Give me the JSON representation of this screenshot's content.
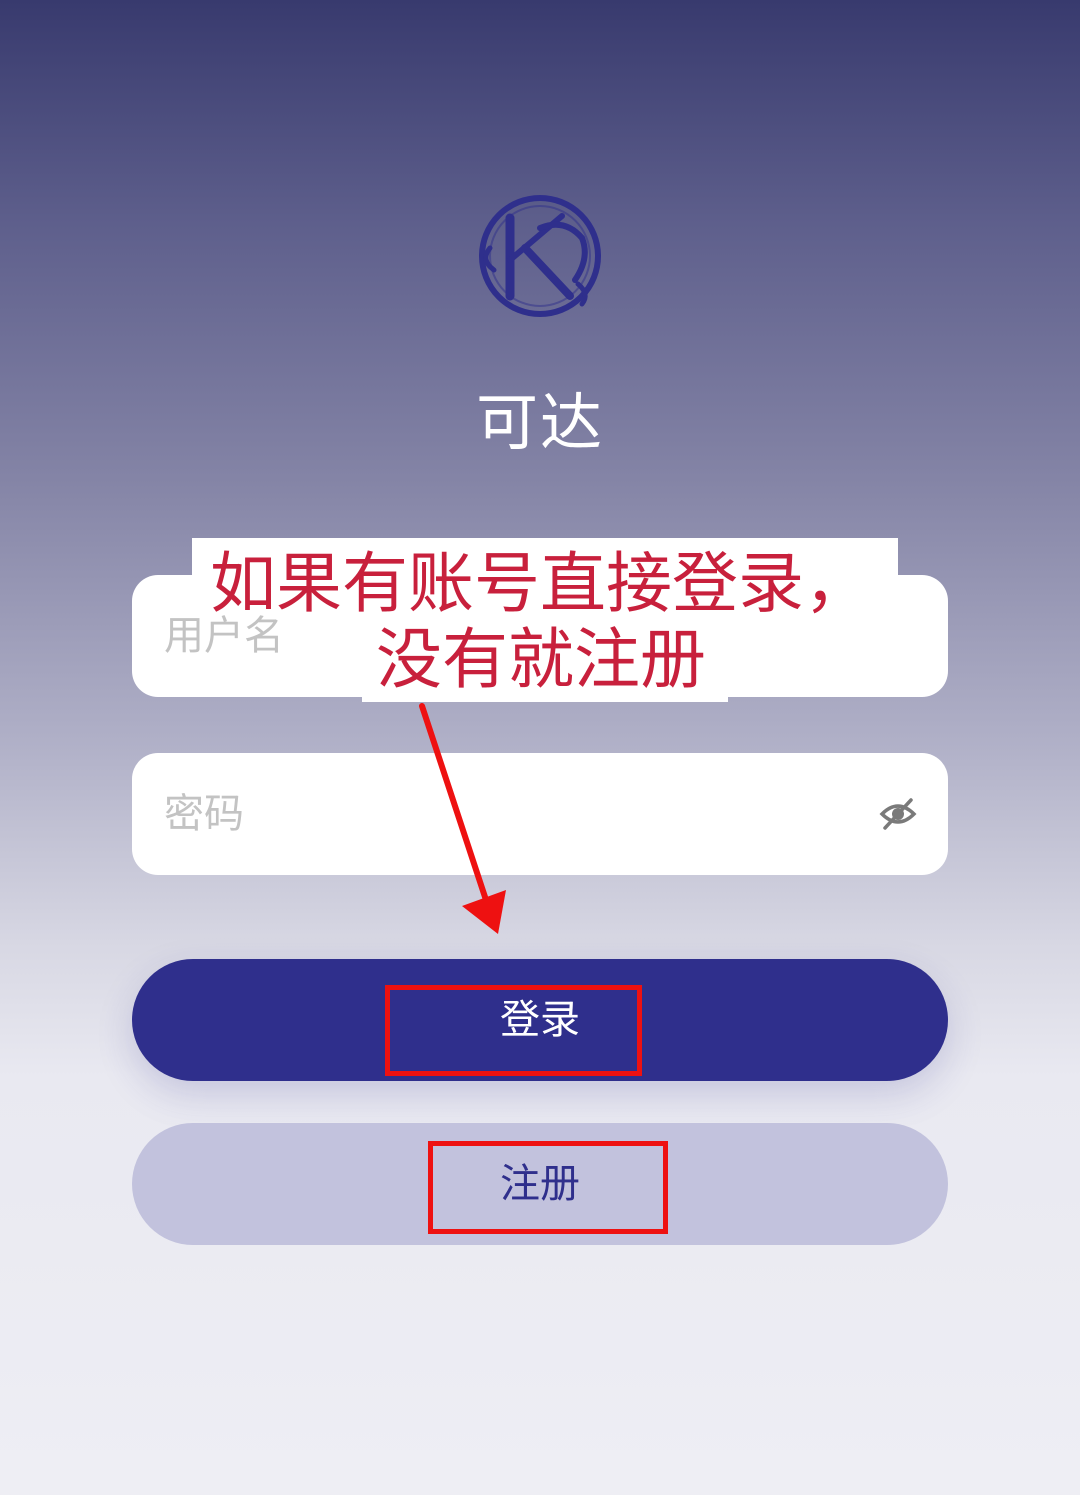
{
  "app": {
    "title": "可达"
  },
  "form": {
    "username_placeholder": "用户名",
    "password_placeholder": "密码",
    "login_label": "登录",
    "register_label": "注册"
  },
  "annotation": {
    "line1": "如果有账号直接登录，",
    "line2": "没有就注册"
  },
  "colors": {
    "primary": "#2f2f8c",
    "secondary_button": "#c2c2dd",
    "annotation_text": "#c8203c",
    "annotation_box": "#ee1111"
  }
}
